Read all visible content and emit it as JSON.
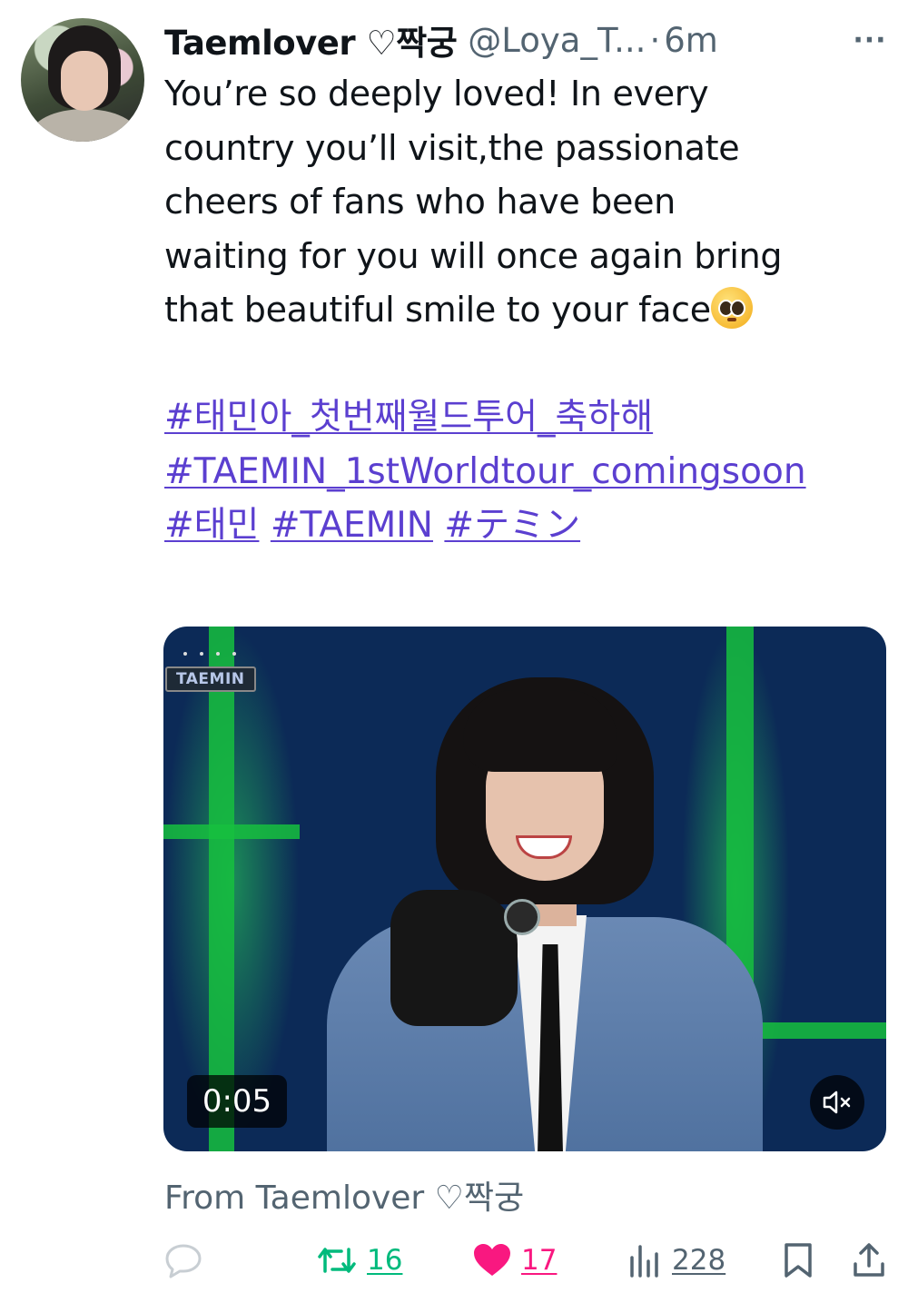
{
  "tweet": {
    "author": {
      "display_name": "Taemlover ♡짝궁",
      "handle": "@Loya_T...",
      "time_separator": "·",
      "time": "6m"
    },
    "more_label": "···",
    "text_lines": [
      "You’re so deeply loved! In every",
      "country you’ll visit,the passionate",
      "cheers of fans who have been",
      "waiting for you will once again bring",
      "that beautiful smile to your face"
    ],
    "hashtags": [
      "#태민아_첫번째월드투어_축하해",
      "#TAEMIN_1stWorldtour_comingsoon",
      "#태민",
      "#TAEMIN",
      "#テミン"
    ],
    "media": {
      "overlay_label": "TAEMIN",
      "video_time": "0:05",
      "mute_icon": "speaker-muted-icon"
    },
    "attribution": "From Taemlover ♡짝궁",
    "actions": {
      "reply_count": "",
      "retweet_count": "16",
      "like_count": "17",
      "views_count": "228"
    },
    "colors": {
      "link": "#5b3fd0",
      "retweet_green": "#00ba7c",
      "like_pink": "#f91880",
      "secondary_text": "#536471"
    }
  }
}
